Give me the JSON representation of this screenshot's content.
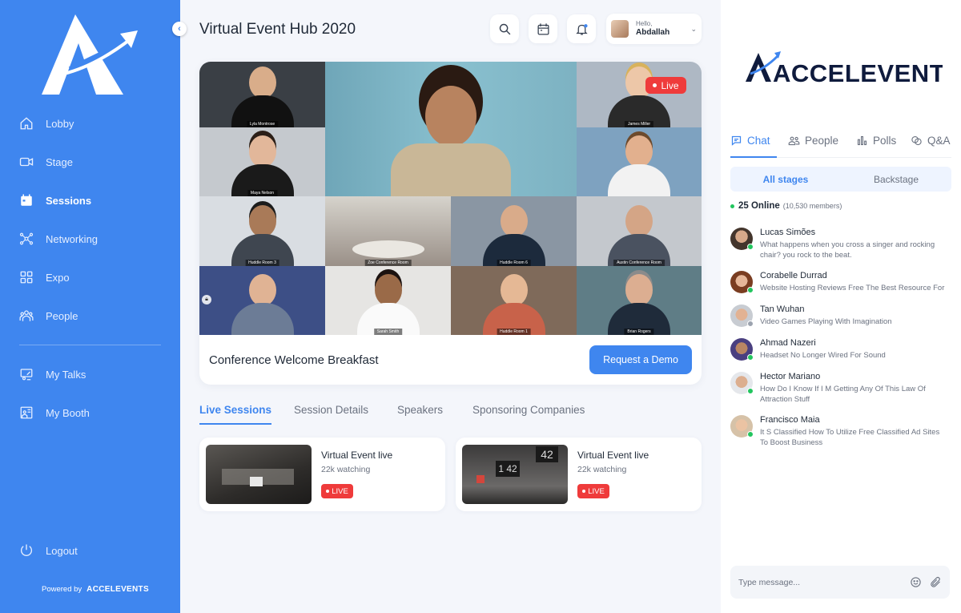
{
  "sidebar": {
    "items": [
      {
        "label": "Lobby",
        "icon": "home-icon"
      },
      {
        "label": "Stage",
        "icon": "video-camera-icon"
      },
      {
        "label": "Sessions",
        "icon": "calendar-icon",
        "active": true
      },
      {
        "label": "Networking",
        "icon": "network-icon"
      },
      {
        "label": "Expo",
        "icon": "grid-icon"
      },
      {
        "label": "People",
        "icon": "people-icon"
      },
      {
        "label": "My Talks",
        "icon": "presentation-icon"
      },
      {
        "label": "My Booth",
        "icon": "booth-icon"
      }
    ],
    "logout": "Logout",
    "powered_by": "Powered by",
    "powered_brand": "ACCELEVENTS",
    "accent_color": "#3f86ef"
  },
  "header": {
    "title": "Virtual Event Hub 2020",
    "hello": "Hello,",
    "user_name": "Abdallah"
  },
  "stage": {
    "live_label": "Live",
    "session_title": "Conference Welcome Breakfast",
    "demo_button": "Request a Demo",
    "tile_captions": [
      "Lyla Montrose",
      "Maya Nelson",
      "James Miller",
      "Zoe Conference Room",
      "Huddle Room 6",
      "Austin Conference Room",
      "Huddle Room 3",
      "Sarah Smith",
      "Huddle Room 1",
      "Brian Rogers"
    ]
  },
  "tabs": [
    "Live Sessions",
    "Session Details",
    "Speakers",
    "Sponsoring Companies"
  ],
  "sessions": [
    {
      "name": "Virtual Event live",
      "watching": "22k watching",
      "badge": "LIVE"
    },
    {
      "name": "Virtual Event live",
      "watching": "22k watching",
      "badge": "LIVE"
    }
  ],
  "panel": {
    "brand": "ACCELEVENTS",
    "tabs": [
      {
        "label": "Chat",
        "icon": "chat-icon"
      },
      {
        "label": "People",
        "icon": "people-icon"
      },
      {
        "label": "Polls",
        "icon": "bar-chart-icon"
      },
      {
        "label": "Q&A",
        "icon": "qa-icon"
      }
    ],
    "segments": [
      "All stages",
      "Backstage"
    ],
    "online_count": "25 Online",
    "members": "(10,530 members)",
    "messages": [
      {
        "name": "Lucas Simões",
        "text": "What happens when you cross a singer and rocking chair? you rock to the beat."
      },
      {
        "name": "Corabelle Durrad",
        "text": "Website Hosting Reviews Free The Best Resource For"
      },
      {
        "name": "Tan Wuhan",
        "text": "Video Games Playing With Imagination"
      },
      {
        "name": "Ahmad Nazeri",
        "text": "Headset No Longer Wired For Sound"
      },
      {
        "name": "Hector Mariano",
        "text": "How Do I Know If I M Getting Any Of This Law Of Attraction Stuff"
      },
      {
        "name": "Francisco Maia",
        "text": "It S Classified How To Utilize Free Classified Ad Sites To Boost Business"
      }
    ],
    "compose_placeholder": "Type message..."
  }
}
